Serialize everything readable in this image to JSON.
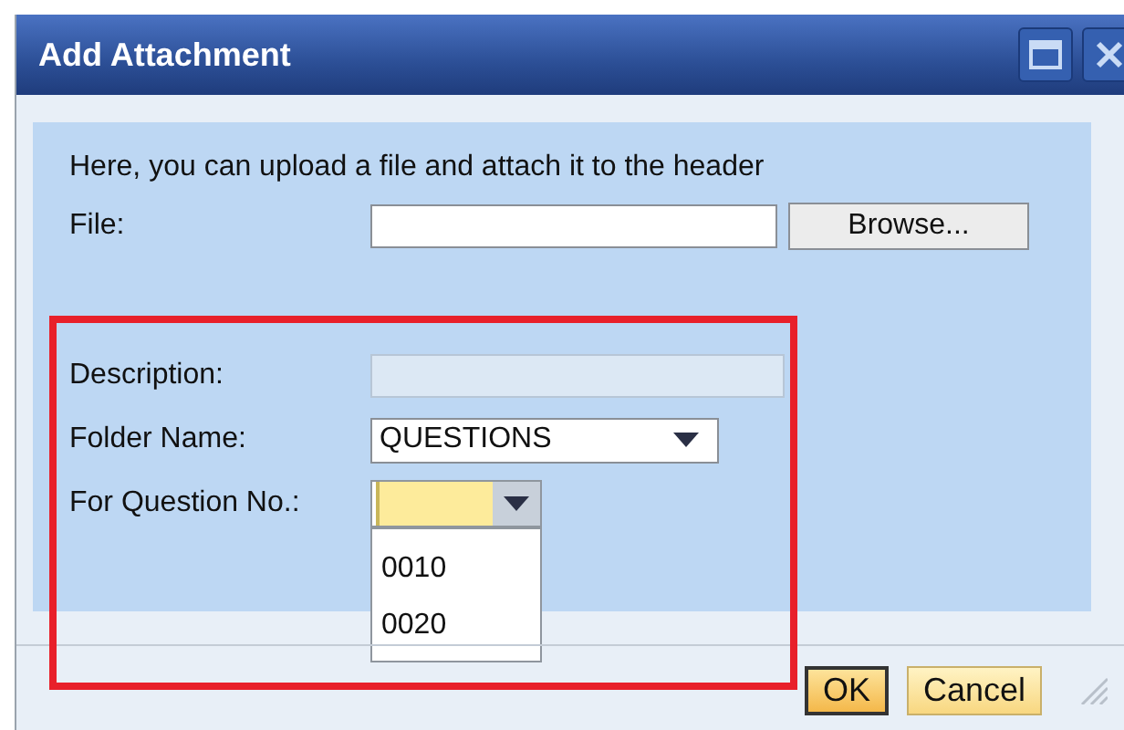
{
  "window": {
    "title": "Add Attachment"
  },
  "intro": "Here, you can upload a file and attach it to the header",
  "fields": [
    {
      "kind": "file",
      "label": "File:",
      "button": "Browse..."
    },
    {
      "kind": "text",
      "label": "Description:",
      "disabled": true
    },
    {
      "kind": "select",
      "label": "Folder Name:",
      "value": "QUESTIONS"
    },
    {
      "kind": "combo",
      "label": "For Question No.:",
      "focused": true,
      "expanded": true,
      "options": [
        "0010",
        "0020"
      ]
    }
  ],
  "buttons": [
    {
      "label": "OK",
      "default": true
    },
    {
      "label": "Cancel",
      "default": false
    }
  ]
}
